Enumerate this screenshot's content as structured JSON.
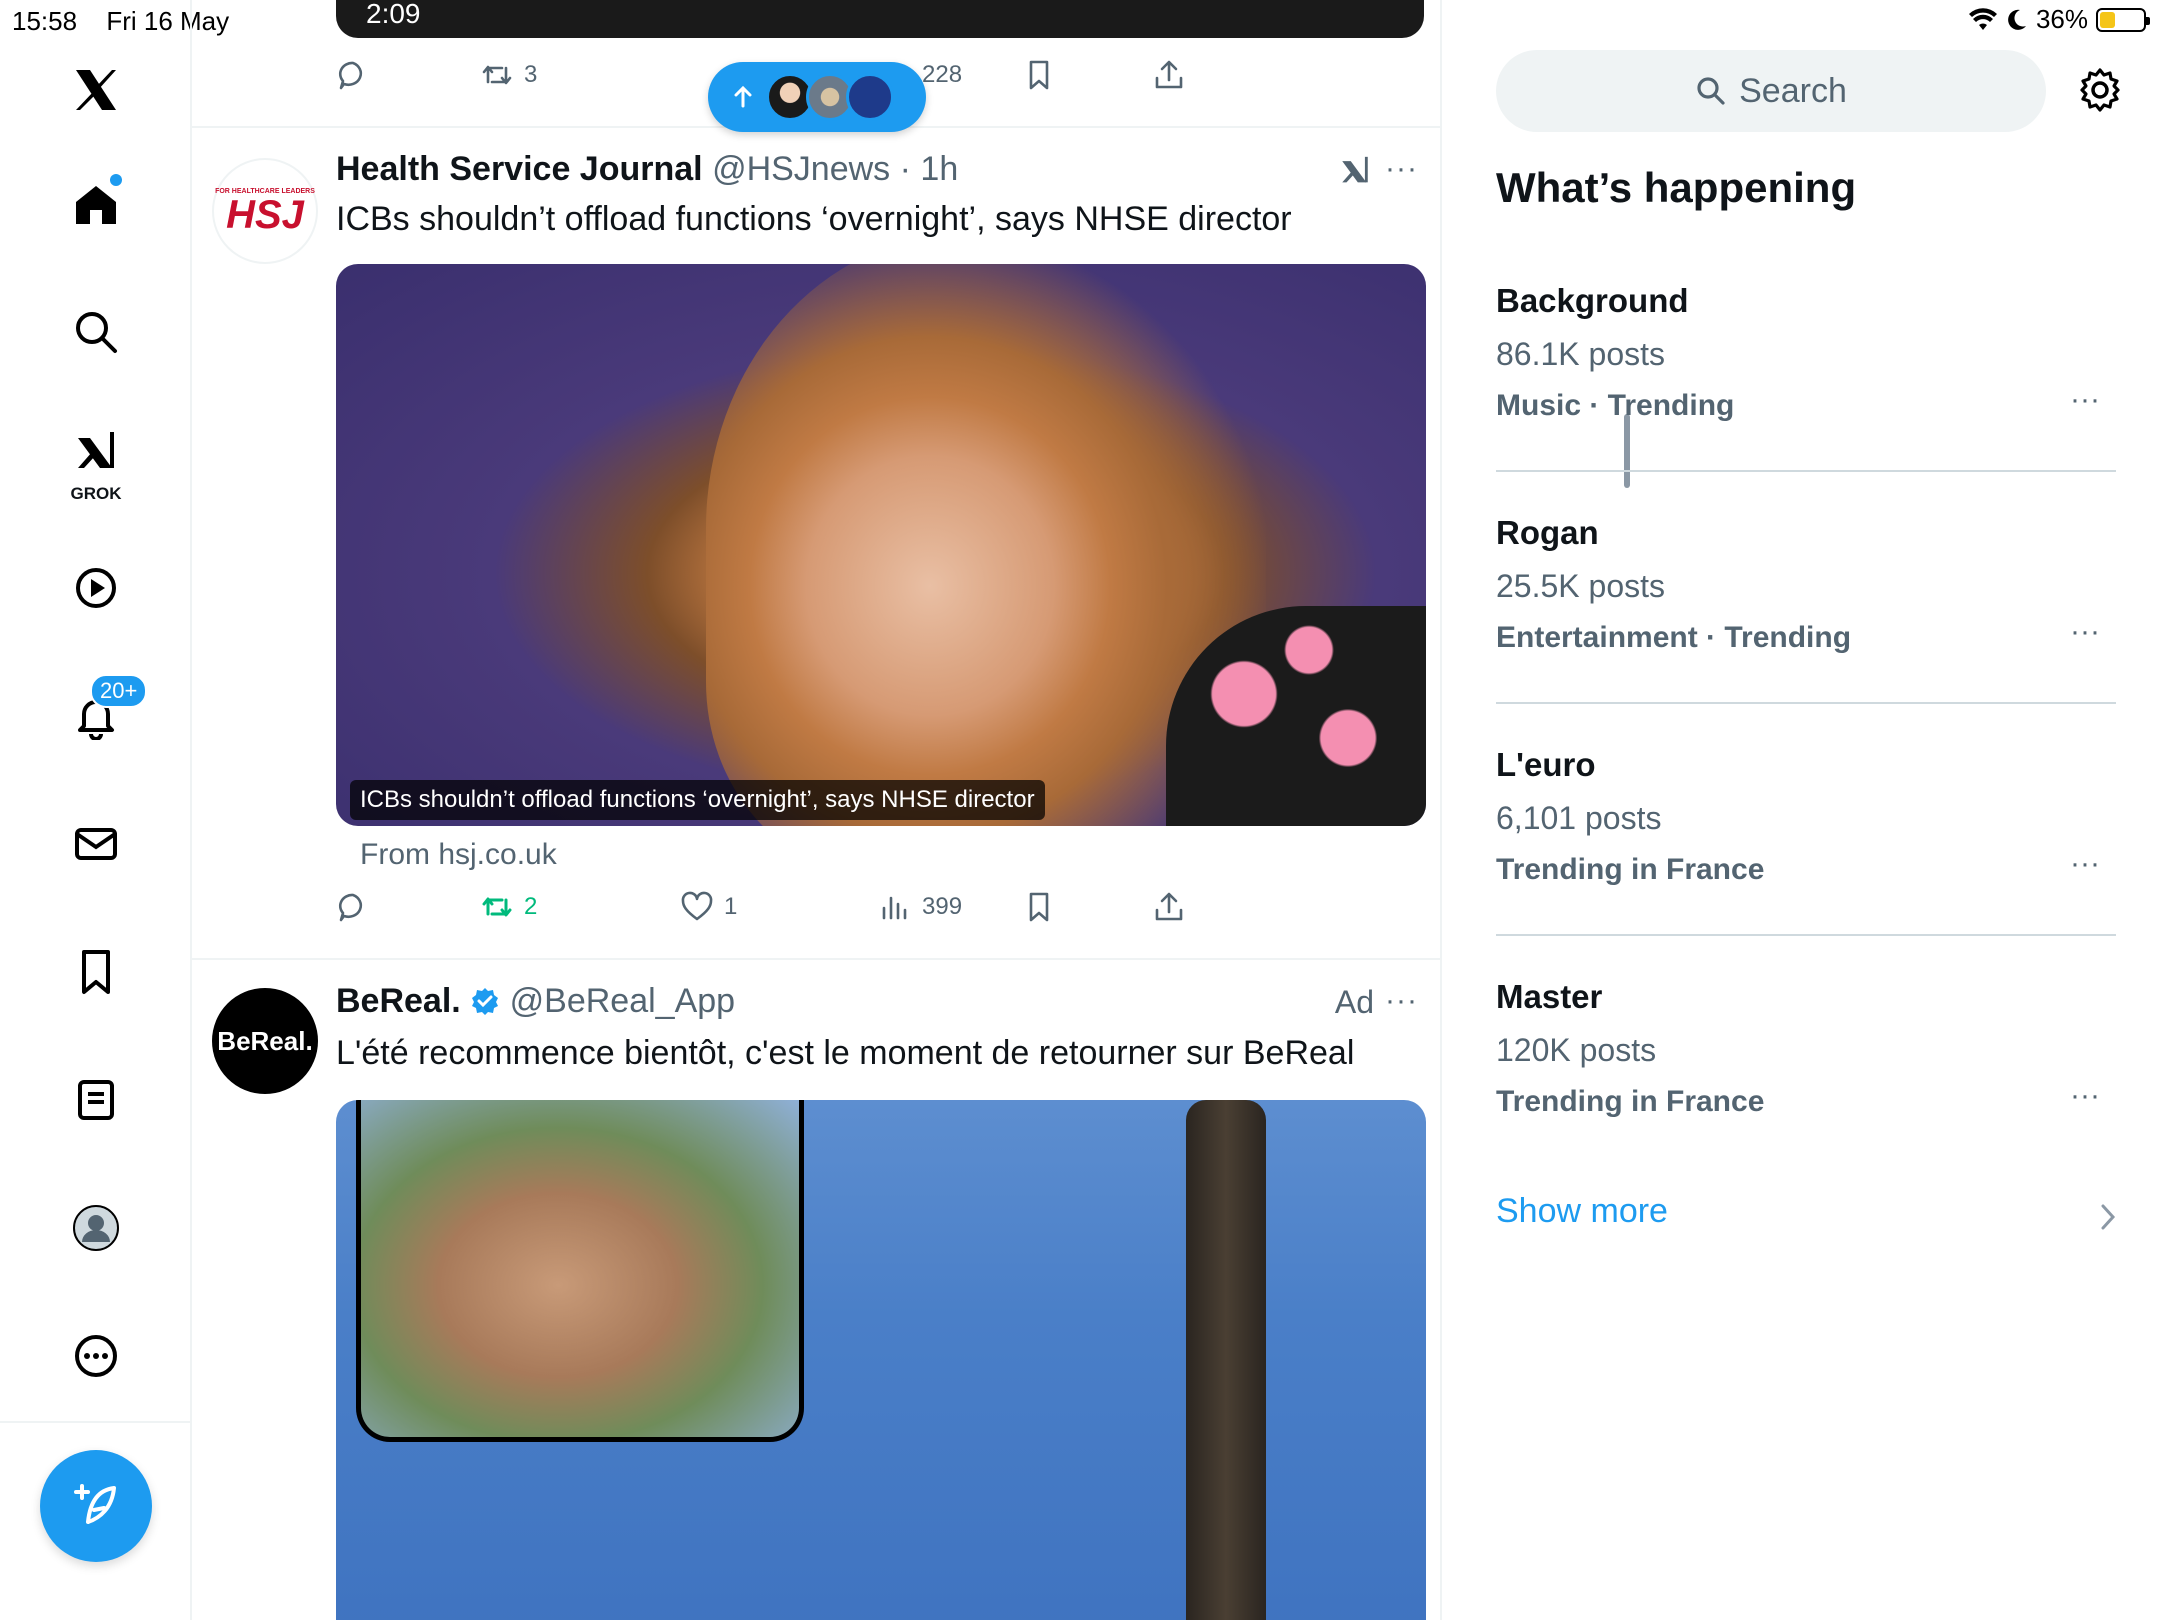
{
  "status_bar": {
    "time": "15:58",
    "date": "Fri 16 May",
    "battery": "36%"
  },
  "nav": {
    "grok_label": "GROK",
    "notifications_badge": "20+"
  },
  "top_tweet": {
    "video_time": "2:09",
    "retweets": "3",
    "views": "228"
  },
  "tweet1": {
    "name": "Health Service Journal",
    "handle": "@HSJnews",
    "time": "· 1h",
    "avatar_text": "HSJ",
    "avatar_subtext": "FOR HEALTHCARE LEADERS",
    "text": "ICBs shouldn’t offload functions ‘overnight’, says NHSE director",
    "media_caption": "ICBs shouldn’t offload functions ‘overnight’, says NHSE director",
    "from": "From hsj.co.uk",
    "retweets": "2",
    "likes": "1",
    "views": "399",
    "more": "···"
  },
  "tweet2": {
    "name": "BeReal.",
    "handle": "@BeReal_App",
    "ad_label": "Ad",
    "avatar_text": "BeReal.",
    "text": "L'été recommence bientôt, c'est le moment de retourner sur BeReal",
    "more": "···"
  },
  "sidebar": {
    "search_placeholder": "Search",
    "title": "What’s happening",
    "trends": [
      {
        "topic": "Background",
        "count": "86.1K posts",
        "meta": "Music · Trending"
      },
      {
        "topic": "Rogan",
        "count": "25.5K posts",
        "meta": "Entertainment · Trending"
      },
      {
        "topic": "L'euro",
        "count": "6,101 posts",
        "meta": "Trending in France"
      },
      {
        "topic": "Master",
        "count": "120K posts",
        "meta": "Trending in France"
      }
    ],
    "show_more": "Show more",
    "dots": "···"
  },
  "colors": {
    "accent": "#1d9bf0",
    "retweet_active": "#00ba7c",
    "muted": "#536471"
  }
}
